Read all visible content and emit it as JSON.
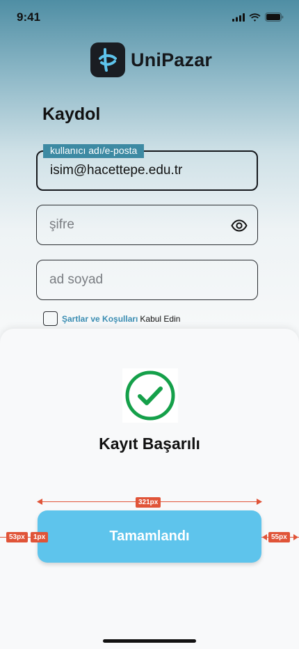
{
  "status_bar": {
    "time": "9:41"
  },
  "brand": {
    "name": "UniPazar"
  },
  "form": {
    "title": "Kaydol",
    "username": {
      "label": "kullanıcı adı/e-posta",
      "value": "isim@hacettepe.edu.tr"
    },
    "password": {
      "placeholder": "şifre"
    },
    "fullname": {
      "placeholder": "ad soyad"
    },
    "terms": {
      "link": "Şartlar ve Koşulları",
      "suffix": "Kabul Edin"
    }
  },
  "sheet": {
    "title": "Kayıt Başarılı",
    "button_label": "Tamamlandı"
  },
  "annotations": {
    "width_label": "321px",
    "left_label": "53px",
    "left_inner_label": "1px",
    "right_label": "55px"
  },
  "colors": {
    "accent": "#5ec4ec",
    "success": "#15a04a",
    "measure": "#e05438",
    "label_bg": "#3d8aa3"
  }
}
